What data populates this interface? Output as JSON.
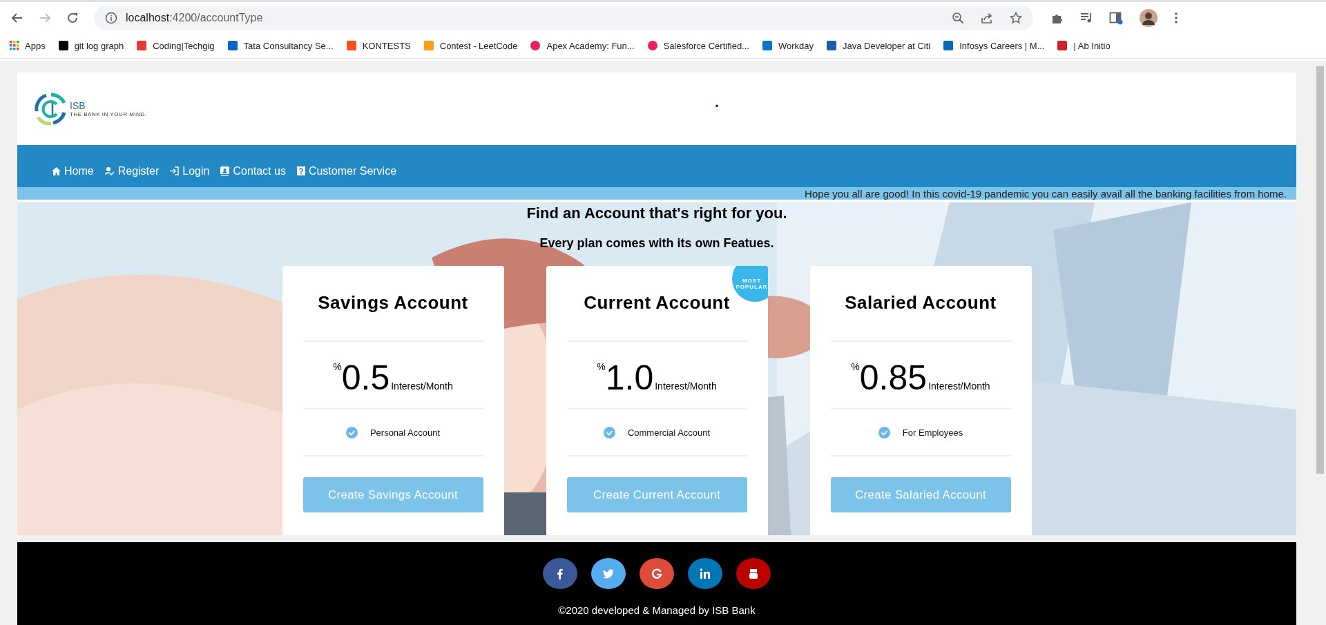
{
  "browser": {
    "url_host": "localhost",
    "url_path": ":4200/accountType",
    "bookmarks": [
      {
        "label": "Apps"
      },
      {
        "label": "git log graph"
      },
      {
        "label": "Coding|Techgig"
      },
      {
        "label": "Tata Consultancy Se..."
      },
      {
        "label": "KONTESTS"
      },
      {
        "label": "Contest - LeetCode"
      },
      {
        "label": "Apex Academy: Fun..."
      },
      {
        "label": "Salesforce Certified..."
      },
      {
        "label": "Workday"
      },
      {
        "label": "Java Developer at Citi"
      },
      {
        "label": "Infosys Careers | M..."
      },
      {
        "label": "| Ab Initio"
      }
    ]
  },
  "header": {
    "logo_name": "ISB",
    "logo_tagline": "THE BANK IN YOUR MIND.",
    "mark": "."
  },
  "nav": [
    {
      "label": "Home"
    },
    {
      "label": "Register"
    },
    {
      "label": "Login"
    },
    {
      "label": "Contact us"
    },
    {
      "label": "Customer Service"
    }
  ],
  "marquee": "Hope you all are good! In this covid-19 pandemic you can easily avail all the banking facilities from home.",
  "hero": {
    "title": "Find an Account that's right for you.",
    "subtitle": "Every plan comes with its own Featues.",
    "plans": [
      {
        "title": "Savings Account",
        "percent": "%",
        "rate": "0.5",
        "unit": "Interest/Month",
        "feature": "Personal Account",
        "button": "Create Savings Account"
      },
      {
        "title": "Current Account",
        "badge": "MOST POPULAR",
        "percent": "%",
        "rate": "1.0",
        "unit": "Interest/Month",
        "feature": "Commercial Account",
        "button": "Create Current Account"
      },
      {
        "title": "Salaried Account",
        "percent": "%",
        "rate": "0.85",
        "unit": "Interest/Month",
        "feature": "For Employees",
        "button": "Create Salaried Account"
      }
    ]
  },
  "footer": {
    "social": [
      {
        "color": "#3b5998"
      },
      {
        "color": "#55acee"
      },
      {
        "color": "#dd4b39"
      },
      {
        "color": "#0077b5"
      },
      {
        "color": "#bb0000"
      }
    ],
    "copyright": "©2020 developed & Managed by ISB Bank"
  }
}
